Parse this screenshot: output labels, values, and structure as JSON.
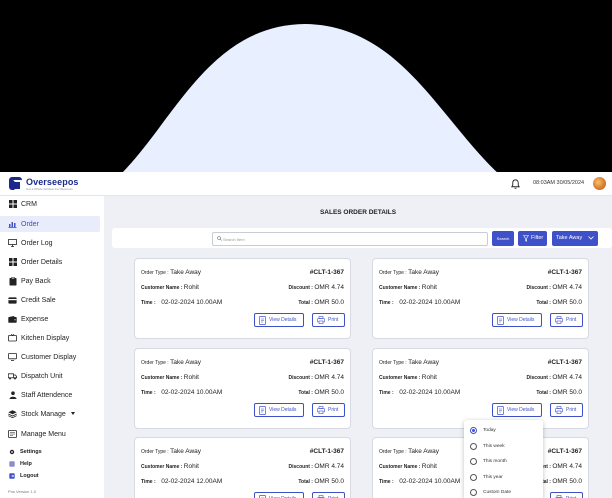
{
  "app": {
    "brand": "Overseepos",
    "tagline": "Get a Whole Solution For Business",
    "datetime": "08:03AM 30/05/2024",
    "version": "Pos Version 1.0"
  },
  "colors": {
    "accent": "#3f51c8",
    "brand": "#1b2a8a",
    "dome": "#e8efff",
    "active_bg": "#e8ecfb"
  },
  "sidebar": {
    "items": [
      {
        "label": "CRM",
        "icon": "grid-icon"
      },
      {
        "label": "Order",
        "icon": "chart-icon",
        "active": true
      },
      {
        "label": "Order Log",
        "icon": "computer-icon"
      },
      {
        "label": "Order Details",
        "icon": "grid-icon"
      },
      {
        "label": "Pay Back",
        "icon": "clipboard-icon"
      },
      {
        "label": "Credit Sale",
        "icon": "card-icon"
      },
      {
        "label": "Expense",
        "icon": "wallet-icon"
      },
      {
        "label": "Kitchen Display",
        "icon": "tv-icon"
      },
      {
        "label": "Customer Display",
        "icon": "monitor-icon"
      },
      {
        "label": "Dispatch Unit",
        "icon": "truck-icon"
      },
      {
        "label": "Staff Attendence",
        "icon": "person-icon"
      },
      {
        "label": "Stock Manage",
        "icon": "stack-icon"
      },
      {
        "label": "Manage Menu",
        "icon": "menu-icon"
      }
    ],
    "footer": [
      {
        "label": "Settings",
        "icon": "gear-icon"
      },
      {
        "label": "Help",
        "icon": "help-icon"
      },
      {
        "label": "Logout",
        "icon": "logout-icon"
      }
    ]
  },
  "main": {
    "title": "SALES ORDER DETAILS",
    "search_placeholder": "Search Item",
    "search_label": "Search",
    "filter_label": "Filter",
    "type_label": "Take Away"
  },
  "filter_menu": {
    "options": [
      "Today",
      "This week",
      "This month",
      "This year",
      "Custom Date"
    ],
    "selected": "Today"
  },
  "card_labels": {
    "type": "Order Type :",
    "customer": "Customer Name :",
    "discount": "Discount :",
    "time": "Time :",
    "total": "Total :",
    "view": "View Details",
    "print": "Print"
  },
  "orders": [
    {
      "type": "Take Away",
      "id": "#CLT-1-367",
      "customer": "Rohit",
      "discount": "OMR 4.74",
      "time": "02-02-2024 10.00AM",
      "total": "OMR 50.0"
    },
    {
      "type": "Take Away",
      "id": "#CLT-1-367",
      "customer": "Rohit",
      "discount": "OMR 4.74",
      "time": "02-02-2024 10.00AM",
      "total": "OMR 50.0"
    },
    {
      "type": "Take Away",
      "id": "#CLT-1-367",
      "customer": "Rohit",
      "discount": "OMR 4.74",
      "time": "02-02-2024 10.00AM",
      "total": "OMR 50.0"
    },
    {
      "type": "Take Away",
      "id": "#CLT-1-367",
      "customer": "Rohit",
      "discount": "OMR 4.74",
      "time": "02-02-2024 10.00AM",
      "total": "OMR 50.0"
    },
    {
      "type": "Take Away",
      "id": "#CLT-1-367",
      "customer": "Rohit",
      "discount": "OMR 4.74",
      "time": "02-02-2024 12.00AM",
      "total": "OMR 50.0"
    },
    {
      "type": "Take Away",
      "id": "#CLT-1-367",
      "customer": "Rohit",
      "discount": "OMR 4.74",
      "time": "02-02-2024 10.00AM",
      "total": "OMR 50.0"
    }
  ]
}
